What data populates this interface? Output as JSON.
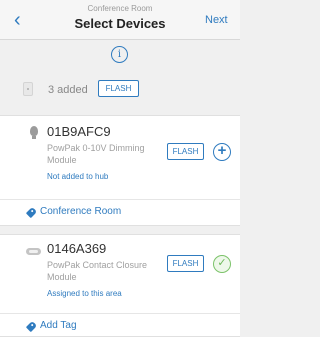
{
  "header": {
    "back_glyph": "‹",
    "subtitle": "Conference Room",
    "title": "Select Devices",
    "next_label": "Next"
  },
  "info": {
    "glyph": "i"
  },
  "summary": {
    "added_text": "3 added",
    "flash_label": "FLASH"
  },
  "devices": [
    {
      "serial": "01B9AFC9",
      "model": "PowPak 0-10V Dimming Module",
      "status": "Not added to hub",
      "flash_label": "FLASH",
      "action_glyph": "+",
      "icon": "bulb-icon",
      "tag_label": "Conference Room"
    },
    {
      "serial": "0146A369",
      "model": "PowPak Contact Closure Module",
      "status": "Assigned to this area",
      "flash_label": "FLASH",
      "action_glyph": "✓",
      "icon": "contact-closure-icon",
      "tag_label": "Add Tag"
    }
  ],
  "colors": {
    "accent": "#2f7bbf",
    "success": "#6db85a",
    "background": "#f0f0f0"
  }
}
